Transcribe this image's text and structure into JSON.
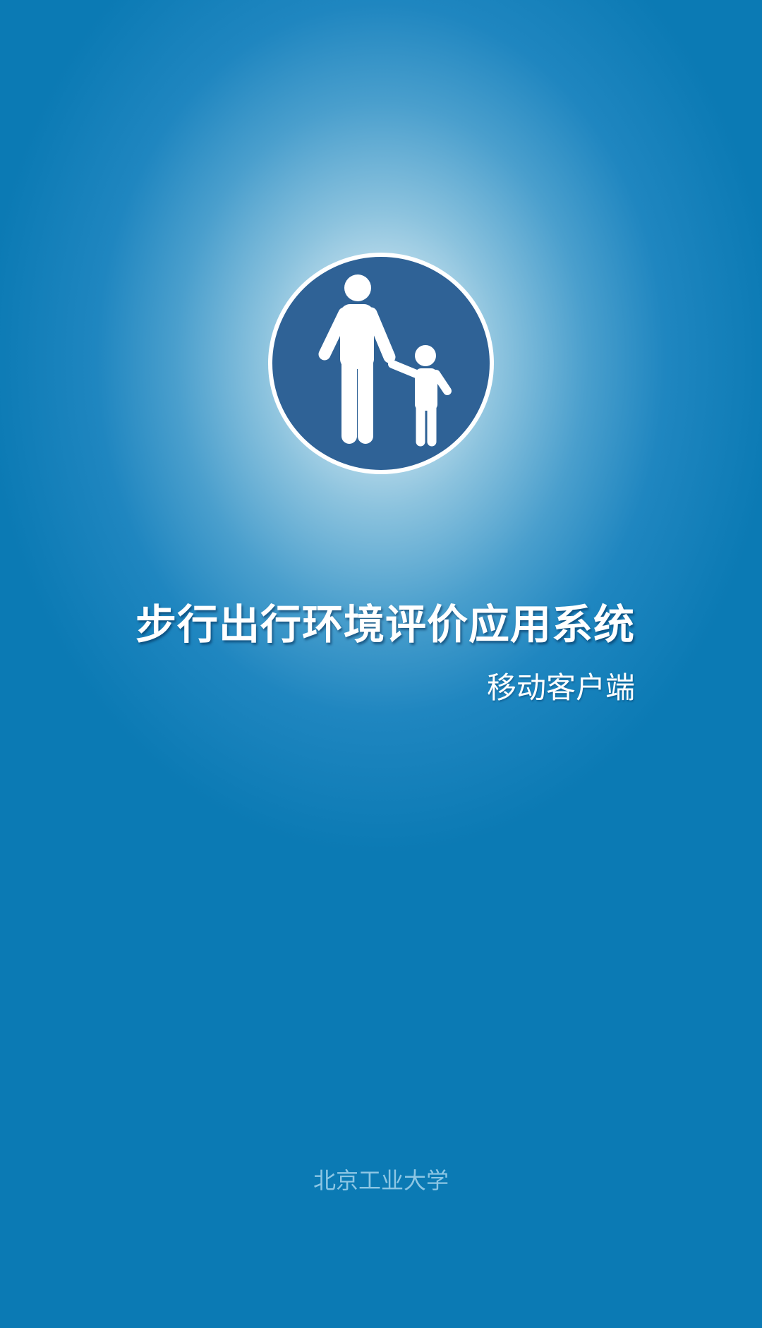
{
  "app": {
    "title": "步行出行环境评价应用系统",
    "subtitle": "移动客户端",
    "organization": "北京工业大学"
  },
  "logo": {
    "icon": "pedestrian-adult-child-icon",
    "circle_color": "#2f6296",
    "figure_color": "#ffffff"
  },
  "colors": {
    "background_center": "#eef6fb",
    "background_edge": "#0b7ab4",
    "title_text": "#ffffff",
    "organization_text": "#8cc6e4"
  }
}
